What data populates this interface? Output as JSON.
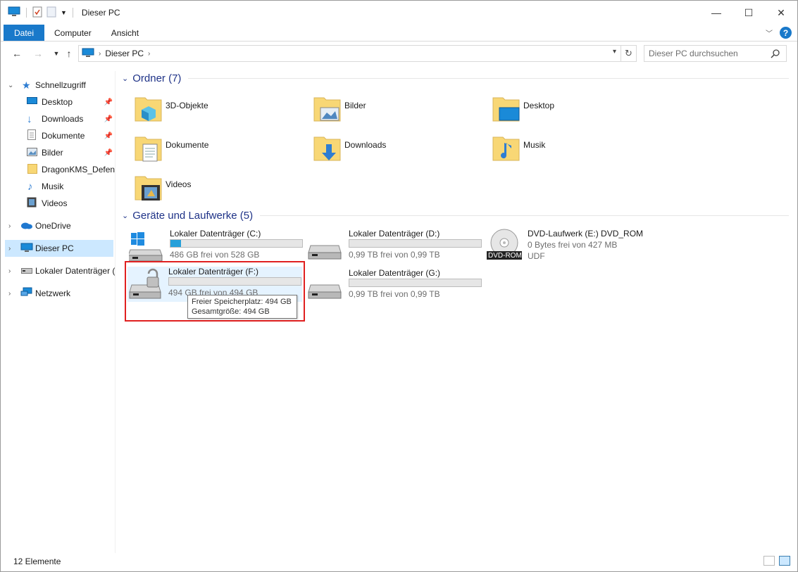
{
  "window": {
    "title": "Dieser PC"
  },
  "ribbon": {
    "tabs": [
      "Datei",
      "Computer",
      "Ansicht"
    ]
  },
  "address": {
    "crumb": "Dieser PC"
  },
  "search": {
    "placeholder": "Dieser PC durchsuchen"
  },
  "sidebar": {
    "quick_access": "Schnellzugriff",
    "quick_items": [
      "Desktop",
      "Downloads",
      "Dokumente",
      "Bilder",
      "DragonKMS_Defend",
      "Musik",
      "Videos"
    ],
    "onedrive": "OneDrive",
    "this_pc": "Dieser PC",
    "local_disk": "Lokaler Datenträger (",
    "network": "Netzwerk"
  },
  "folders": {
    "header": "Ordner (7)",
    "items": [
      "3D-Objekte",
      "Bilder",
      "Desktop",
      "Dokumente",
      "Downloads",
      "Musik",
      "Videos"
    ]
  },
  "drives": {
    "header": "Geräte und Laufwerke (5)",
    "items": [
      {
        "name": "Lokaler Datenträger (C:)",
        "info": "486 GB frei von 528 GB",
        "used_fraction": 0.08
      },
      {
        "name": "Lokaler Datenträger (D:)",
        "info": "0,99 TB frei von 0,99 TB",
        "used_fraction": 0.0
      },
      {
        "name": "DVD-Laufwerk (E:) DVD_ROM",
        "info": "0 Bytes frei von 427 MB",
        "fs": "UDF",
        "badge": "DVD-ROM"
      },
      {
        "name": "Lokaler Datenträger (F:)",
        "info": "494 GB frei von 494 GB",
        "used_fraction": 0.0
      },
      {
        "name": "Lokaler Datenträger (G:)",
        "info": "0,99 TB frei von 0,99 TB",
        "used_fraction": 0.0
      }
    ]
  },
  "tooltip": {
    "line1": "Freier Speicherplatz: 494 GB",
    "line2": "Gesamtgröße: 494 GB"
  },
  "status": {
    "count": "12 Elemente"
  },
  "colors": {
    "accent": "#1979ca",
    "folder": "#f8d775",
    "bar": "#26a0da",
    "highlight": "#e02020"
  }
}
